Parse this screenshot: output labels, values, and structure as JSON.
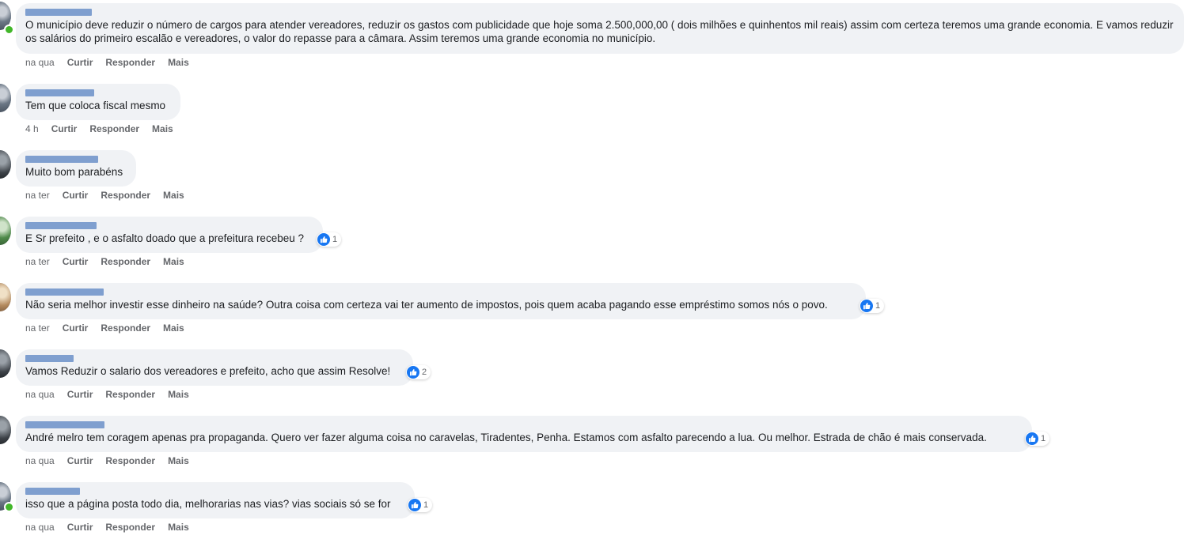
{
  "comments": [
    {
      "text": "O município deve reduzir o número de cargos para atender vereadores, reduzir os gastos com publicidade que hoje soma 2.500,000,00 ( dois milhões e quinhentos mil reais) assim com certeza teremos uma grande economia. E vamos reduzir os salários do primeiro escalão e vereadores, o valor do repasse para a câmara. Assim teremos uma grande economia no município.",
      "time": "na qua",
      "like": "Curtir",
      "reply": "Responder",
      "more": "Mais",
      "reactions": ""
    },
    {
      "text": "Tem que coloca fiscal mesmo",
      "time": "4 h",
      "like": "Curtir",
      "reply": "Responder",
      "more": "Mais",
      "reactions": ""
    },
    {
      "text": "Muito bom parabéns",
      "time": "na ter",
      "like": "Curtir",
      "reply": "Responder",
      "more": "Mais",
      "reactions": ""
    },
    {
      "text": "E Sr prefeito , e o asfalto doado que a prefeitura recebeu ?",
      "time": "na ter",
      "like": "Curtir",
      "reply": "Responder",
      "more": "Mais",
      "reactions": "1"
    },
    {
      "text": "Não seria melhor investir esse dinheiro na saúde? Outra coisa com certeza vai ter aumento de impostos, pois quem acaba pagando esse empréstimo somos nós o povo.",
      "time": "na ter",
      "like": "Curtir",
      "reply": "Responder",
      "more": "Mais",
      "reactions": "1"
    },
    {
      "text": "Vamos Reduzir o salario dos vereadores e prefeito, acho que assim Resolve!",
      "time": "na qua",
      "like": "Curtir",
      "reply": "Responder",
      "more": "Mais",
      "reactions": "2"
    },
    {
      "text": "André melro tem coragem apenas pra propaganda. Quero ver fazer alguma coisa no caravelas, Tiradentes, Penha. Estamos com asfalto parecendo a lua. Ou melhor. Estrada de chão é mais conservada.",
      "time": "na qua",
      "like": "Curtir",
      "reply": "Responder",
      "more": "Mais",
      "reactions": "1"
    },
    {
      "text": "isso que a página posta todo dia, melhorarias nas vias? vias sociais só se for",
      "time": "na qua",
      "like": "Curtir",
      "reply": "Responder",
      "more": "Mais",
      "reactions": "1"
    }
  ],
  "colors": {
    "bubble": "#f0f2f5",
    "like_blue": "#1877f2",
    "meta_gray": "#65676b",
    "redaction": "#7f9fcf",
    "online": "#42b72a"
  },
  "icons": {
    "reaction": "like-thumbs-up-icon",
    "presence": "online-status-dot"
  }
}
